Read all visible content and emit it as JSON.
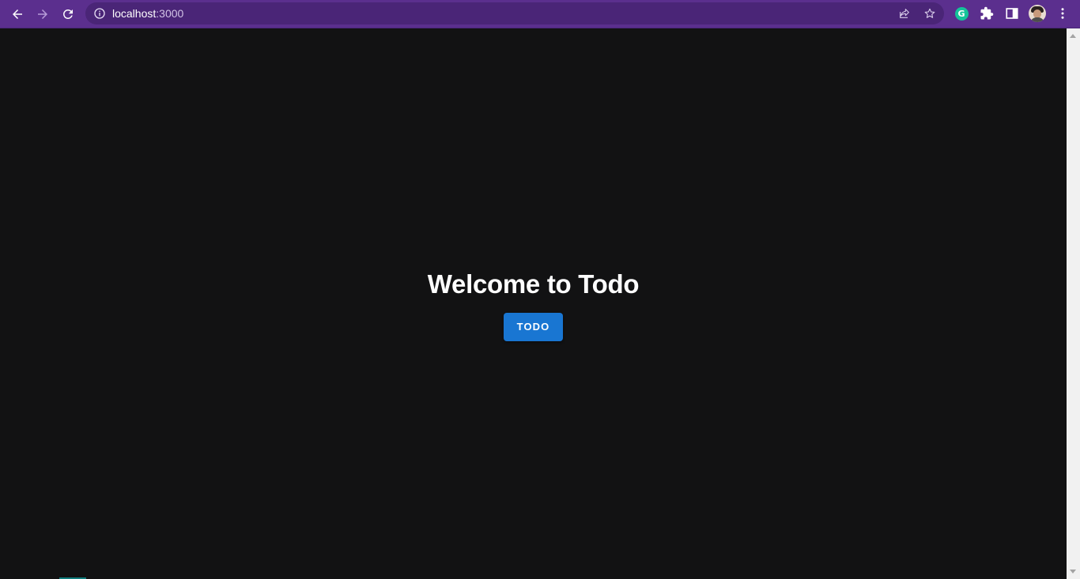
{
  "browser": {
    "url_host": "localhost",
    "url_port": ":3000",
    "icons": {
      "back": "arrow-left-icon",
      "forward": "arrow-right-icon",
      "reload": "reload-icon",
      "site_info": "info-icon",
      "share": "share-icon",
      "bookmark": "star-icon",
      "extension_grammarly": "grammarly-icon",
      "extensions": "puzzle-icon",
      "side_panel": "side-panel-icon",
      "profile": "avatar",
      "menu": "kebab-menu-icon"
    },
    "grammarly_letter": "G"
  },
  "page": {
    "heading": "Welcome to Todo",
    "button_label": "TODO"
  },
  "colors": {
    "chrome_bg": "#5b2f8e",
    "omnibox_bg": "#4a2577",
    "page_bg": "#121213",
    "button_bg": "#1976d2",
    "text": "#ffffff"
  }
}
